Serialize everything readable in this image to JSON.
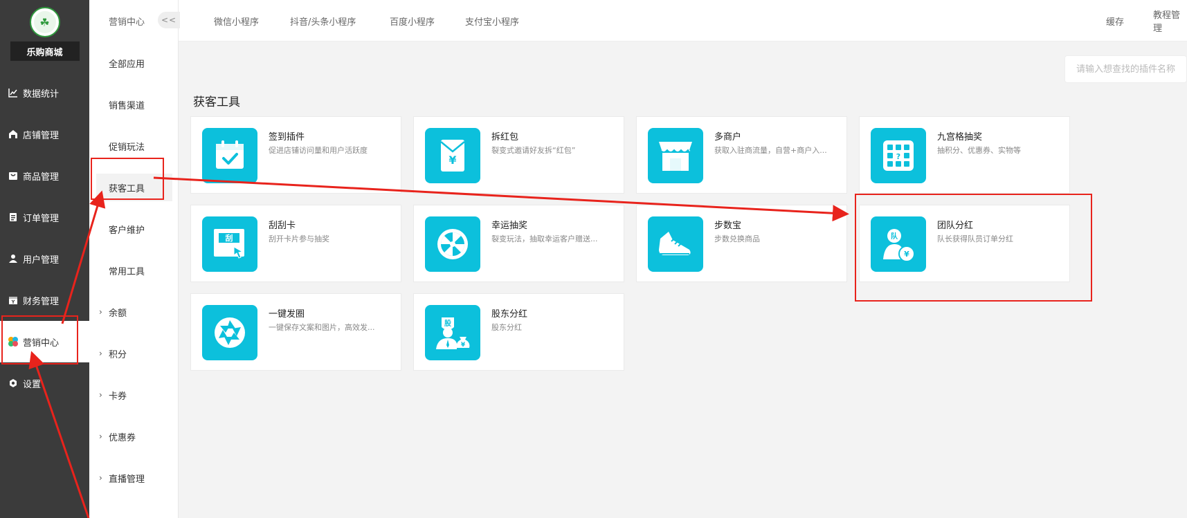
{
  "app": {
    "shop_name": "乐购商城"
  },
  "sidebar": {
    "items": [
      {
        "label": "数据统计",
        "icon": "chart-line-icon"
      },
      {
        "label": "店铺管理",
        "icon": "store-icon"
      },
      {
        "label": "商品管理",
        "icon": "goods-icon"
      },
      {
        "label": "订单管理",
        "icon": "order-icon"
      },
      {
        "label": "用户管理",
        "icon": "user-icon"
      },
      {
        "label": "财务管理",
        "icon": "finance-icon"
      },
      {
        "label": "营销中心",
        "icon": "marketing-icon"
      },
      {
        "label": "设置",
        "icon": "settings-gear-icon"
      }
    ]
  },
  "submenu": {
    "header": "营销中心",
    "collapse_label": "<<",
    "items": [
      {
        "label": "全部应用"
      },
      {
        "label": "销售渠道"
      },
      {
        "label": "促销玩法"
      },
      {
        "label": "获客工具"
      },
      {
        "label": "客户维护"
      },
      {
        "label": "常用工具"
      },
      {
        "label": "余额"
      },
      {
        "label": "积分"
      },
      {
        "label": "卡券"
      },
      {
        "label": "优惠券"
      },
      {
        "label": "直播管理"
      }
    ]
  },
  "topbar": {
    "tabs": [
      "微信小程序",
      "抖音/头条小程序",
      "百度小程序",
      "支付宝小程序"
    ],
    "right": [
      "缓存",
      "教程管理"
    ]
  },
  "search": {
    "placeholder": "请输入想查找的插件名称"
  },
  "section": {
    "title": "获客工具"
  },
  "cards": [
    {
      "name": "签到插件",
      "desc": "促进店铺访问量和用户活跃度",
      "icon": "calendar-check-icon"
    },
    {
      "name": "拆红包",
      "desc": "裂变式邀请好友拆“红包”",
      "icon": "red-envelope-icon"
    },
    {
      "name": "多商户",
      "desc": "获取入驻商流量，自营+商户入...",
      "icon": "shop-front-icon"
    },
    {
      "name": "九宫格抽奖",
      "desc": "抽积分、优惠券、实物等",
      "icon": "grid-lottery-icon"
    },
    {
      "name": "刮刮卡",
      "desc": "刮开卡片参与抽奖",
      "icon": "scratch-card-icon"
    },
    {
      "name": "幸运抽奖",
      "desc": "裂变玩法，抽取幸运客户赠送...",
      "icon": "wheel-icon"
    },
    {
      "name": "步数宝",
      "desc": "步数兑换商品",
      "icon": "sneaker-icon"
    },
    {
      "name": "团队分红",
      "desc": "队长获得队员订单分红",
      "icon": "team-dividend-icon"
    },
    {
      "name": "一键发圈",
      "desc": "一键保存文案和图片，高效发...",
      "icon": "aperture-icon"
    },
    {
      "name": "股东分红",
      "desc": "股东分红",
      "icon": "shareholder-dividend-icon"
    }
  ],
  "icon_text": {
    "scratch": "刮",
    "grid": "?",
    "team": "队",
    "yen": "¥",
    "share": "股"
  },
  "colors": {
    "accent": "#0cc0dc",
    "sidebar": "#3b3b3b",
    "annotation": "#e8231c"
  }
}
